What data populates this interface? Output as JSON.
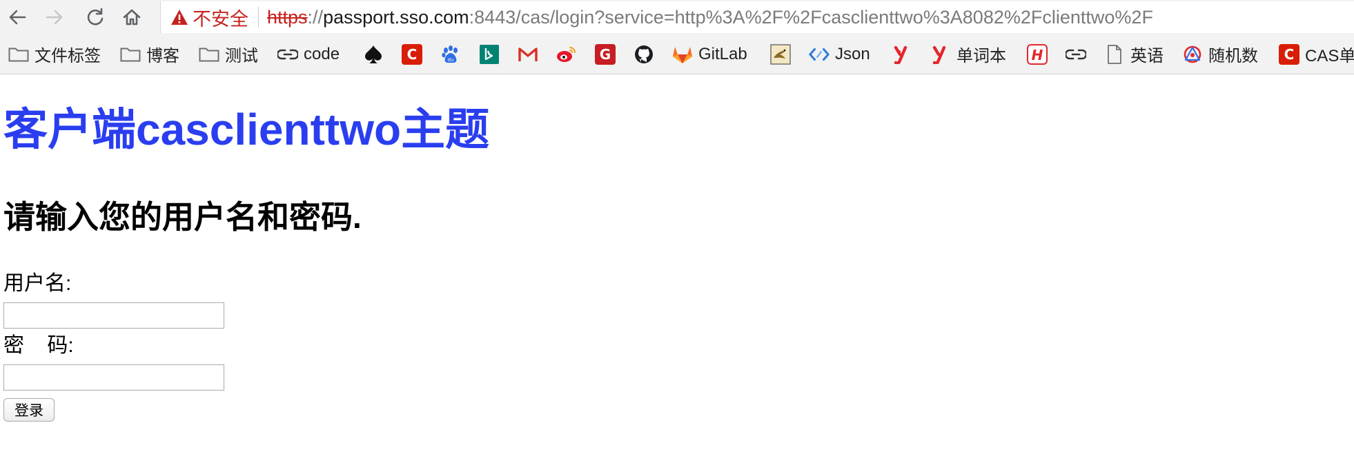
{
  "browser": {
    "security": {
      "icon": "warning-triangle-icon",
      "label": "不安全",
      "color": "#c5221f"
    },
    "url": {
      "scheme": "https",
      "slashes": "://",
      "host": "passport.sso.com",
      "rest": ":8443/cas/login?service=http%3A%2F%2Fcasclienttwo%3A8082%2Fclienttwo%2F"
    },
    "nav_icons": {
      "back": "back-arrow-icon",
      "forward": "forward-arrow-icon",
      "reload": "reload-icon",
      "home": "home-icon"
    }
  },
  "bookmarks": [
    {
      "label": "文件标签",
      "icon": "folder-icon"
    },
    {
      "label": "博客",
      "icon": "folder-icon"
    },
    {
      "label": "测试",
      "icon": "folder-icon"
    },
    {
      "label": "code",
      "icon": "link-icon"
    },
    {
      "label": "",
      "icon": "spade-icon"
    },
    {
      "label": "",
      "icon": "csdn-icon",
      "color": "#d81e06"
    },
    {
      "label": "",
      "icon": "baidu-paw-icon",
      "color": "#2f6fe4"
    },
    {
      "label": "",
      "icon": "bing-icon",
      "color": "#008373"
    },
    {
      "label": "",
      "icon": "gmail-icon",
      "color": "#d93025"
    },
    {
      "label": "",
      "icon": "weibo-icon",
      "color": "#e6162d"
    },
    {
      "label": "",
      "icon": "gitee-icon",
      "color": "#c71d23"
    },
    {
      "label": "",
      "icon": "github-icon",
      "color": "#1b1f23"
    },
    {
      "label": "GitLab",
      "icon": "gitlab-icon",
      "color": "#fc6d26"
    },
    {
      "label": "",
      "icon": "bird-image-icon"
    },
    {
      "label": "Json",
      "icon": "code-brackets-icon",
      "color": "#2f7de1"
    },
    {
      "label": "",
      "icon": "youdao-icon",
      "color": "#e3262c"
    },
    {
      "label": "单词本",
      "icon": "youdao-icon",
      "color": "#e3262c"
    },
    {
      "label": "",
      "icon": "h-logo-icon",
      "color": "#e3262c"
    },
    {
      "label": "",
      "icon": "link-icon"
    },
    {
      "label": "英语",
      "icon": "page-icon"
    },
    {
      "label": "随机数",
      "icon": "dice-icon",
      "color": "#e3262c"
    },
    {
      "label": "CAS单",
      "icon": "csdn-icon",
      "color": "#d81e06"
    }
  ],
  "page": {
    "title": "客户端casclienttwo主题",
    "title_color": "#2a3ef0",
    "subtitle": "请输入您的用户名和密码.",
    "username_label": "用户名:",
    "username_value": "",
    "password_label": "密    码:",
    "password_value": "",
    "submit_label": "登录"
  }
}
